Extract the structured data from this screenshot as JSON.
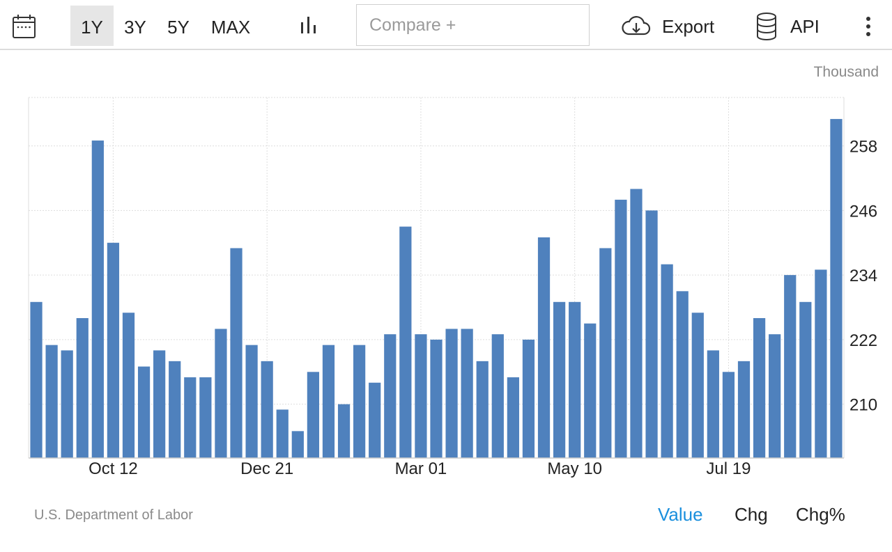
{
  "toolbar": {
    "ranges": [
      "1Y",
      "3Y",
      "5Y",
      "MAX"
    ],
    "active_range": "1Y",
    "compare_placeholder": "Compare +",
    "export_label": "Export",
    "api_label": "API",
    "icons": {
      "calendar": "calendar-icon",
      "chart_type": "bar-chart-icon",
      "export": "cloud-download-icon",
      "api": "database-icon",
      "more": "more-vertical-icon"
    }
  },
  "unit_label": "Thousand",
  "source": "U.S. Department of Labor",
  "view_tabs": [
    "Value",
    "Chg",
    "Chg%"
  ],
  "active_view": "Value",
  "colors": {
    "bar": "#4f81bd",
    "active_tab": "#1a8fdd",
    "grid": "#dddddd",
    "text": "#222222",
    "muted": "#8a8a8a"
  },
  "chart_data": {
    "type": "bar",
    "ylim": [
      200,
      267
    ],
    "y_ticks": [
      210,
      222,
      234,
      246,
      258
    ],
    "x_tick_labels": [
      "Oct 12",
      "Dec 21",
      "Mar 01",
      "May 10",
      "Jul 19"
    ],
    "x_tick_bar_index": [
      5,
      15,
      25,
      35,
      45
    ],
    "grid": true,
    "y_axis_side": "right",
    "series": [
      {
        "values": [
          229,
          221,
          220,
          226,
          259,
          240,
          227,
          217,
          220,
          218,
          215,
          215,
          224,
          239,
          221,
          218,
          209,
          205,
          216,
          221,
          210,
          221,
          214,
          223,
          243,
          223,
          222,
          224,
          224,
          218,
          223,
          215,
          222,
          241,
          229,
          229,
          225,
          239,
          248,
          250,
          246,
          236,
          231,
          227,
          220,
          216,
          218,
          226,
          223,
          234,
          229,
          235,
          263
        ]
      }
    ]
  }
}
